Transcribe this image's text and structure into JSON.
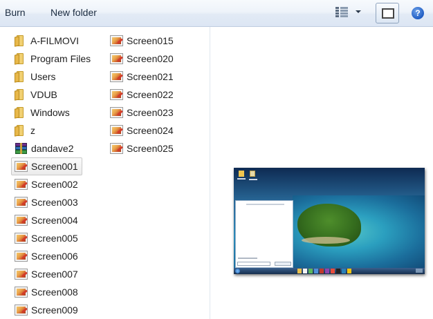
{
  "toolbar": {
    "burn_label": "Burn",
    "new_folder_label": "New folder",
    "icons": [
      "views-icon",
      "views-dropdown-arrow",
      "preview-pane-icon",
      "help-icon"
    ],
    "help_glyph": "?"
  },
  "file_list": {
    "column_1": [
      {
        "label": "A-FILMOVI",
        "type": "folder"
      },
      {
        "label": "Program Files",
        "type": "folder"
      },
      {
        "label": "Users",
        "type": "folder"
      },
      {
        "label": "VDUB",
        "type": "folder"
      },
      {
        "label": "Windows",
        "type": "folder"
      },
      {
        "label": "z",
        "type": "folder"
      },
      {
        "label": "dandave2",
        "type": "archive"
      },
      {
        "label": "Screen001",
        "type": "image",
        "selected": true
      },
      {
        "label": "Screen002",
        "type": "image"
      },
      {
        "label": "Screen003",
        "type": "image"
      },
      {
        "label": "Screen004",
        "type": "image"
      },
      {
        "label": "Screen005",
        "type": "image"
      },
      {
        "label": "Screen006",
        "type": "image"
      },
      {
        "label": "Screen007",
        "type": "image"
      },
      {
        "label": "Screen008",
        "type": "image"
      },
      {
        "label": "Screen009",
        "type": "image"
      }
    ],
    "column_2": [
      {
        "label": "Screen015",
        "type": "image"
      },
      {
        "label": "Screen020",
        "type": "image"
      },
      {
        "label": "Screen021",
        "type": "image"
      },
      {
        "label": "Screen022",
        "type": "image"
      },
      {
        "label": "Screen023",
        "type": "image"
      },
      {
        "label": "Screen024",
        "type": "image"
      },
      {
        "label": "Screen025",
        "type": "image"
      }
    ]
  },
  "preview": {
    "subject": "desktop screenshot thumbnail"
  },
  "colors": {
    "toolbar_text": "#1a2b40",
    "selection_border": "#c9c9c9",
    "folder": "#e8b84a"
  }
}
